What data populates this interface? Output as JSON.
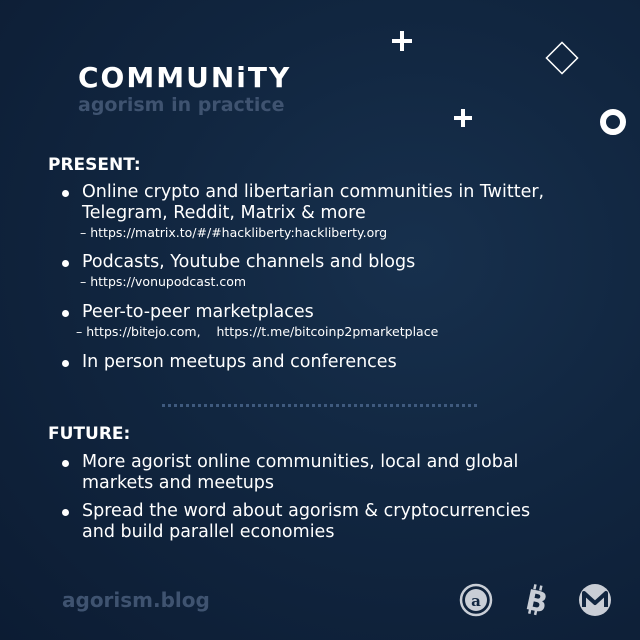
{
  "header": {
    "title": "COMMUNiTY",
    "subtitle": "agorism in practice"
  },
  "present": {
    "heading": "PRESENT:",
    "items": [
      {
        "text_line1": "Online crypto and libertarian communities in Twitter,",
        "text_line2": "Telegram, Reddit, Matrix & more",
        "link": "– https://matrix.to/#/#hackliberty:hackliberty.org"
      },
      {
        "text_line1": "Podcasts, Youtube channels and blogs",
        "link": "– https://vonupodcast.com"
      },
      {
        "text_line1": "Peer-to-peer marketplaces",
        "link": "– https://bitejo.com,    https://t.me/bitcoinp2pmarketplace"
      },
      {
        "text_line1": "In person meetups and conferences"
      }
    ]
  },
  "future": {
    "heading": "FUTURE:",
    "items": [
      {
        "text_line1": "More agorist online communities, local and global",
        "text_line2": "markets and meetups"
      },
      {
        "text_line1": "Spread the word about agorism & cryptocurrencies",
        "text_line2": "and build parallel economies"
      }
    ]
  },
  "footer": {
    "site": "agorism.blog",
    "icons": [
      "agorism-a-icon",
      "bitcoin-icon",
      "monero-icon"
    ]
  },
  "colors": {
    "background": "#112640",
    "muted_text": "#3f5370",
    "accent": "#ffffff"
  }
}
